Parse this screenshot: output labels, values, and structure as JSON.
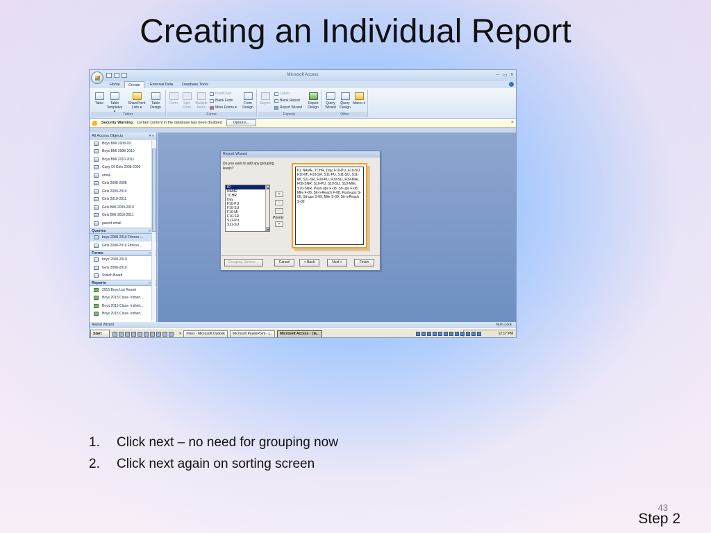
{
  "slide": {
    "title": "Creating an Individual Report",
    "steps": [
      {
        "num": "1.",
        "text": "Click next – no need for grouping now"
      },
      {
        "num": "2.",
        "text": "Click next again on sorting screen"
      }
    ],
    "slide_number": "43",
    "step_label": "Step 2"
  },
  "app": {
    "title": "Microsoft Access",
    "controls": [
      "–",
      "▭",
      "x"
    ],
    "tabs": [
      "Home",
      "Create",
      "External Data",
      "Database Tools"
    ],
    "active_tab": "Create",
    "ribbon": {
      "tables": {
        "label": "Tables",
        "buttons": [
          "Table",
          "Table Templates ▾",
          "SharePoint Lists ▾",
          "Table Design"
        ]
      },
      "forms": {
        "label": "Forms",
        "buttons": [
          "Form",
          "Split Form",
          "Multiple Items"
        ],
        "small": [
          "PivotChart",
          "Blank Form",
          "More Forms ▾"
        ],
        "design": "Form Design"
      },
      "reports": {
        "label": "Reports",
        "buttons": [
          "Report"
        ],
        "small": [
          "Labels",
          "Blank Report",
          "Report Wizard"
        ],
        "design": "Report Design"
      },
      "other": {
        "label": "Other",
        "buttons": [
          "Query Wizard",
          "Query Design",
          "Macro ▾"
        ]
      }
    },
    "security": {
      "title": "Security Warning",
      "message": "Certain content in the database has been disabled",
      "button": "Options..."
    },
    "nav": {
      "header": "All Access Objects",
      "tables": [
        "Boys BMI 2008-09",
        "Boys BMI 2008-2010",
        "Boys BMI 2010-2011",
        "Copy Of Girls 2008-2009",
        "email",
        "Girls 2008-2008",
        "Girls 2009-2010",
        "Girls 2010-2011",
        "Girls BMI 2009-2010",
        "Girls BMI 2010-2011",
        "parent email"
      ],
      "queries_label": "Queries",
      "queries": [
        "boys 2008-2010 Fitness ...",
        "Girls 2008-2010 Fitness ..."
      ],
      "forms_label": "Forms",
      "forms": [
        "boys 2008-2010",
        "Girls 2008-2010",
        "Switch Board"
      ],
      "reports_label": "Reports",
      "reports": [
        "2015 Boys List Report",
        "Boys 2015 Class- Individ...",
        "Boys 2015 Class- Individ...",
        "Boys 2015 Class- Individ..."
      ]
    },
    "wizard": {
      "title": "Report Wizard",
      "question": "Do you want to add any grouping levels?",
      "fields": [
        "ID",
        "NAME",
        "TCHR",
        "Day",
        "F10-PU",
        "F10-SU",
        "F10-MI",
        "F10-SR",
        "S11-PU",
        "S11-SU"
      ],
      "selected_field": "ID",
      "move_buttons": [
        ">",
        "<",
        "<<",
        "+",
        "+"
      ],
      "priority_label": "Priority",
      "preview_text": "ID, NAME, TCHR, Day, F10-PU, F10-SU, F10-MI, F10-SR, S11-PU, S11-SU, S11-MI, S11-SR, F09-PU, F09-SU, F09-Mile, F09-SNR, S10-PU, S10-SU, S10-Mile, S10-SNR, Push-ups F-08, Sit-ups F-08, Mile F-08, Sit-n-Reach F-08, Push-ups S-09, Sit-ups S-09, Mile S-09, Sit-n-Reach S-09",
      "buttons": {
        "grouping": "Grouping Options ...",
        "cancel": "Cancel",
        "back": "< Back",
        "next": "Next >",
        "finish": "Finish"
      }
    },
    "status": {
      "left": "Report Wizard",
      "right": "Num Lock"
    },
    "taskbar": {
      "start": "Start",
      "chevron": "»",
      "windows": [
        "Inbox - Microsoft Outlook",
        "Microsoft PowerPoint - [...",
        "Microsoft Access - cla..."
      ],
      "active_window": 2,
      "clock": "12:17 PM"
    }
  }
}
